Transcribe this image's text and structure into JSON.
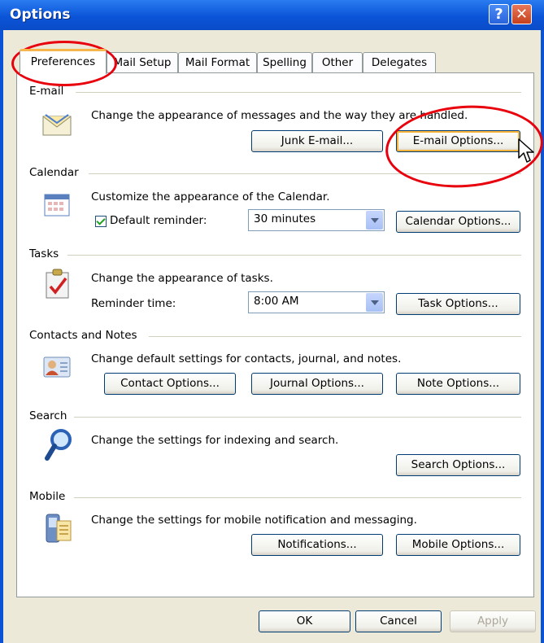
{
  "window": {
    "title": "Options"
  },
  "tabs": [
    "Preferences",
    "Mail Setup",
    "Mail Format",
    "Spelling",
    "Other",
    "Delegates"
  ],
  "email": {
    "group": "E-mail",
    "description": "Change the appearance of messages and the way they are handled.",
    "junk_button": "Junk E-mail...",
    "options_button": "E-mail Options..."
  },
  "calendar": {
    "group": "Calendar",
    "description": "Customize the appearance of the Calendar.",
    "reminder_label": "Default reminder:",
    "reminder_value": "30 minutes",
    "options_button": "Calendar Options..."
  },
  "tasks": {
    "group": "Tasks",
    "description": "Change the appearance of tasks.",
    "reminder_label": "Reminder time:",
    "reminder_value": "8:00 AM",
    "options_button": "Task Options..."
  },
  "contacts": {
    "group": "Contacts and Notes",
    "description": "Change default settings for contacts, journal, and notes.",
    "contact_button": "Contact Options...",
    "journal_button": "Journal Options...",
    "note_button": "Note Options..."
  },
  "search": {
    "group": "Search",
    "description": "Change the settings for indexing and search.",
    "options_button": "Search Options..."
  },
  "mobile": {
    "group": "Mobile",
    "description": "Change the settings for mobile notification and messaging.",
    "notifications_button": "Notifications...",
    "options_button": "Mobile Options..."
  },
  "footer": {
    "ok": "OK",
    "cancel": "Cancel",
    "apply": "Apply"
  },
  "colors": {
    "title_bar": "#0b54d8",
    "annotation": "#e8000c",
    "dialog_bg": "#ece9d8"
  }
}
